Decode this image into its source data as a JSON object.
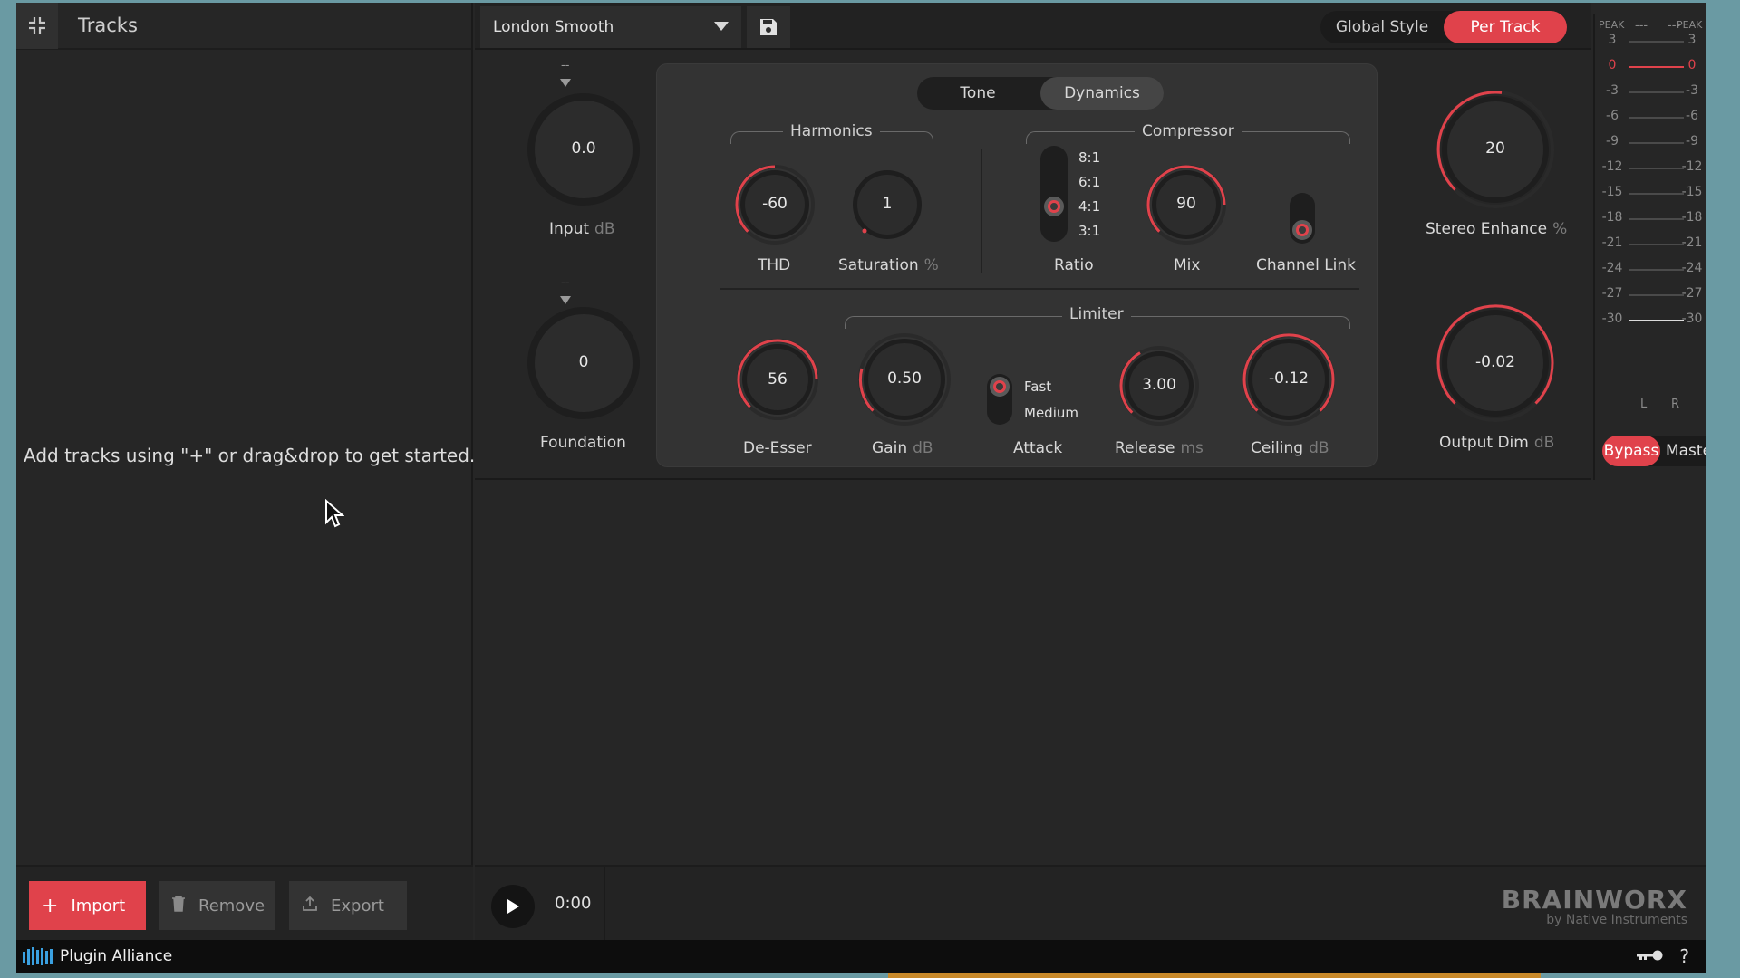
{
  "left": {
    "title": "Tracks",
    "empty_message": "Add tracks using \"+\" or drag&drop to get started.",
    "buttons": {
      "import": "Import",
      "remove": "Remove",
      "export": "Export"
    }
  },
  "topbar": {
    "preset": "London Smooth",
    "style_options": {
      "global": "Global Style",
      "per_track": "Per Track"
    },
    "selected_style": "Per Track"
  },
  "input": {
    "value": "0.0",
    "label": "Input",
    "unit": "dB",
    "indicator": "--"
  },
  "foundation": {
    "value": "0",
    "label": "Foundation",
    "indicator": "--"
  },
  "tabs": {
    "tone": "Tone",
    "dynamics": "Dynamics",
    "selected": "Dynamics"
  },
  "harmonics": {
    "title": "Harmonics",
    "thd": {
      "value": "-60",
      "label": "THD"
    },
    "saturation": {
      "value": "1",
      "label": "Saturation",
      "unit": "%"
    }
  },
  "compressor": {
    "title": "Compressor",
    "ratio": {
      "label": "Ratio",
      "options": [
        "8:1",
        "6:1",
        "4:1",
        "3:1"
      ],
      "selected": "4:1"
    },
    "mix": {
      "value": "90",
      "label": "Mix"
    },
    "channel_link": {
      "label": "Channel Link"
    }
  },
  "limiter": {
    "title": "Limiter",
    "de_esser": {
      "value": "56",
      "label": "De-Esser"
    },
    "gain": {
      "value": "0.50",
      "label": "Gain",
      "unit": "dB"
    },
    "attack": {
      "label": "Attack",
      "options": [
        "Fast",
        "Medium"
      ],
      "selected": "Fast"
    },
    "release": {
      "value": "3.00",
      "label": "Release",
      "unit": "ms"
    },
    "ceiling": {
      "value": "-0.12",
      "label": "Ceiling",
      "unit": "dB"
    }
  },
  "stereo_enhance": {
    "value": "20",
    "label": "Stereo Enhance",
    "unit": "%"
  },
  "output_dim": {
    "value": "-0.02",
    "label": "Output Dim",
    "unit": "dB"
  },
  "meter": {
    "peak_label": "PEAK",
    "peak_left": "---",
    "peak_right": "---",
    "scale": [
      "3",
      "0",
      "-3",
      "-6",
      "-9",
      "-12",
      "-15",
      "-18",
      "-21",
      "-24",
      "-27",
      "-30"
    ],
    "channels": {
      "left": "L",
      "right": "R"
    },
    "bypass": "Bypass",
    "master": "Master"
  },
  "transport": {
    "time": "0:00"
  },
  "brand": {
    "name": "BRAINWORX",
    "sub": "by Native Instruments"
  },
  "status": {
    "app": "Plugin Alliance",
    "help": "?"
  },
  "colors": {
    "accent": "#e0424b",
    "panel": "#333333",
    "background": "#262626"
  }
}
